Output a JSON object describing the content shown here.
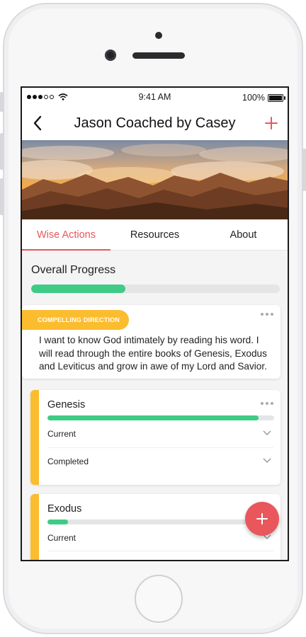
{
  "status_bar": {
    "time": "9:41 AM",
    "battery": "100%"
  },
  "nav": {
    "title": "Jason Coached by Casey",
    "back_icon": "chevron-left-icon",
    "add_icon": "plus-icon"
  },
  "tabs": [
    {
      "label": "Wise Actions",
      "active": true
    },
    {
      "label": "Resources",
      "active": false
    },
    {
      "label": "About",
      "active": false
    }
  ],
  "overall_progress": {
    "label": "Overall Progress",
    "fraction": 0.38
  },
  "direction": {
    "tag": "COMPELLING DIRECTION",
    "text": "I want to know God intimately by reading his word. I will read through the entire books of Genesis, Exodus and Leviticus and grow in awe of my Lord and Savior."
  },
  "books": [
    {
      "title": "Genesis",
      "progress": 0.93,
      "rows": [
        "Current",
        "Completed"
      ]
    },
    {
      "title": "Exodus",
      "progress": 0.09,
      "rows": [
        "Current"
      ]
    }
  ],
  "colors": {
    "accent": "#e9575c",
    "progress": "#3fcb85",
    "tag": "#fbbc2e"
  }
}
